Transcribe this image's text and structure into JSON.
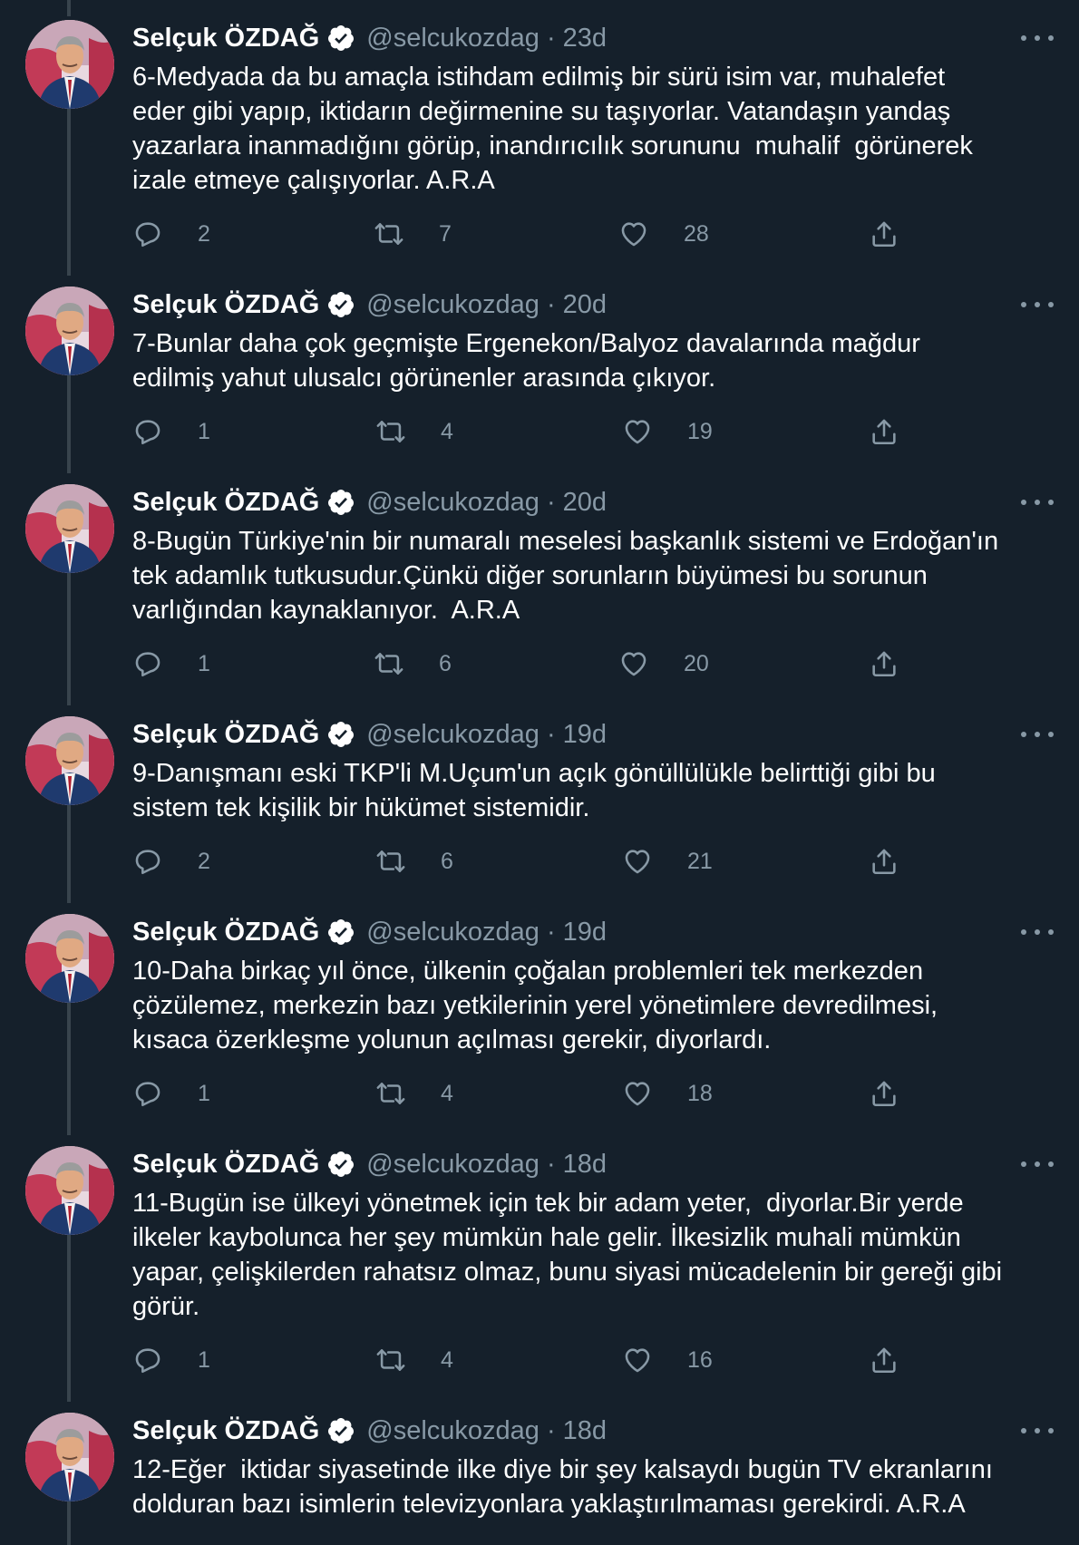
{
  "author": {
    "name": "Selçuk ÖZDAĞ",
    "handle": "@selcukozdag",
    "separator": "·"
  },
  "colors": {
    "background": "#15202b",
    "muted": "#8899a6",
    "thread_line": "#38444d",
    "text": "#ffffff"
  },
  "icons": {
    "reply": "reply-icon",
    "retweet": "retweet-icon",
    "like": "like-icon",
    "share": "share-icon",
    "verified": "verified-badge-icon",
    "more": "more-icon"
  },
  "tweets": [
    {
      "time": "23d",
      "text": "6-Medyada da bu amaçla istihdam edilmiş bir sürü isim var, muhalefet\neder gibi yapıp, iktidarın değirmenine su taşıyorlar. Vatandaşın yandaş\nyazarlara inanmadığını görüp, inandırıcılık sorununu  muhalif  görünerek\nizale etmeye çalışıyorlar. A.R.A",
      "replies": "2",
      "retweets": "7",
      "likes": "28"
    },
    {
      "time": "20d",
      "text": "7-Bunlar daha çok geçmişte Ergenekon/Balyoz davalarında mağdur\nedilmiş yahut ulusalcı görünenler arasında çıkıyor.",
      "replies": "1",
      "retweets": "4",
      "likes": "19"
    },
    {
      "time": "20d",
      "text": "8-Bugün Türkiye'nin bir numaralı meselesi başkanlık sistemi ve Erdoğan'ın\ntek adamlık tutkusudur.Çünkü diğer sorunların büyümesi bu sorunun\nvarlığından kaynaklanıyor.  A.R.A",
      "replies": "1",
      "retweets": "6",
      "likes": "20"
    },
    {
      "time": "19d",
      "text": "9-Danışmanı eski TKP'li M.Uçum'un açık gönüllülükle belirttiği gibi bu\nsistem tek kişilik bir hükümet sistemidir.",
      "replies": "2",
      "retweets": "6",
      "likes": "21"
    },
    {
      "time": "19d",
      "text": "10-Daha birkaç yıl önce, ülkenin çoğalan problemleri tek merkezden\nçözülemez, merkezin bazı yetkilerinin yerel yönetimlere devredilmesi,\nkısaca özerkleşme yolunun açılması gerekir, diyorlardı.",
      "replies": "1",
      "retweets": "4",
      "likes": "18"
    },
    {
      "time": "18d",
      "text": "11-Bugün ise ülkeyi yönetmek için tek bir adam yeter,  diyorlar.Bir yerde\nilkeler kaybolunca her şey mümkün hale gelir. İlkesizlik muhali mümkün\nyapar, çelişkilerden rahatsız olmaz, bunu siyasi mücadelenin bir gereği gibi\ngörür.",
      "replies": "1",
      "retweets": "4",
      "likes": "16"
    },
    {
      "time": "18d",
      "text": "12-Eğer  iktidar siyasetinde ilke diye bir şey kalsaydı bugün TV ekranlarını\ndolduran bazı isimlerin televizyonlara yaklaştırılmaması gerekirdi. A.R.A",
      "replies": "",
      "retweets": "",
      "likes": ""
    }
  ]
}
